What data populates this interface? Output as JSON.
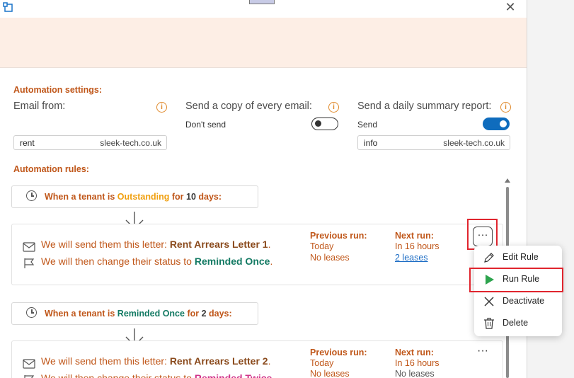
{
  "window": {
    "close_glyph": "✕"
  },
  "settings": {
    "title": "Automation settings:",
    "email_from_label": "Email from:",
    "email_from_local": "rent",
    "email_from_domain": "sleek-tech.co.uk",
    "copy_label": "Send a copy of every email:",
    "copy_state": "Don't send",
    "copy_enabled": false,
    "summary_label": "Send a daily summary report:",
    "summary_state": "Send",
    "summary_enabled": true,
    "summary_local": "info",
    "summary_domain": "sleek-tech.co.uk",
    "info_glyph": "i"
  },
  "rules_title": "Automation rules:",
  "rules": [
    {
      "trigger_prefix": "When a tenant is ",
      "status": "Outstanding",
      "trigger_mid": " for ",
      "days": "10",
      "trigger_suffix": " days:",
      "letter_prefix": "We will send them this letter: ",
      "letter": "Rent Arrears Letter 1",
      "letter_end": ".",
      "change_prefix": "We will then change their status to ",
      "new_status": "Reminded Once",
      "change_end": ".",
      "previous_run_label": "Previous run:",
      "previous_run": "Today",
      "previous_result": "No leases",
      "next_run_label": "Next run:",
      "next_run": "In 16 hours",
      "next_result": "2 leases"
    },
    {
      "trigger_prefix": "When a tenant is ",
      "status": "Reminded Once",
      "trigger_mid": " for ",
      "days": "2",
      "trigger_suffix": " days:",
      "letter_prefix": "We will send them this letter: ",
      "letter": "Rent Arrears Letter 2",
      "letter_end": ".",
      "change_prefix": "We will then change their status to ",
      "new_status": "Reminded Twice",
      "previous_run_label": "Previous run:",
      "previous_run": "Today",
      "previous_result": "No leases",
      "next_run_label": "Next run:",
      "next_run": "In 16 hours",
      "next_result": "No leases"
    }
  ],
  "more_glyph": "···",
  "context_menu": {
    "items": [
      {
        "label": "Edit Rule",
        "icon": "pencil-icon"
      },
      {
        "label": "Run Rule",
        "icon": "play-icon"
      },
      {
        "label": "Deactivate",
        "icon": "x-icon"
      },
      {
        "label": "Delete",
        "icon": "trash-icon"
      }
    ]
  },
  "colors": {
    "accent": "#c0571a",
    "outstanding": "#f0a010",
    "reminded": "#137a63",
    "reminded_twice": "#d0338a",
    "toggle_on": "#0f6cbd",
    "highlight_box": "#e0252e",
    "play": "#2da44e"
  }
}
